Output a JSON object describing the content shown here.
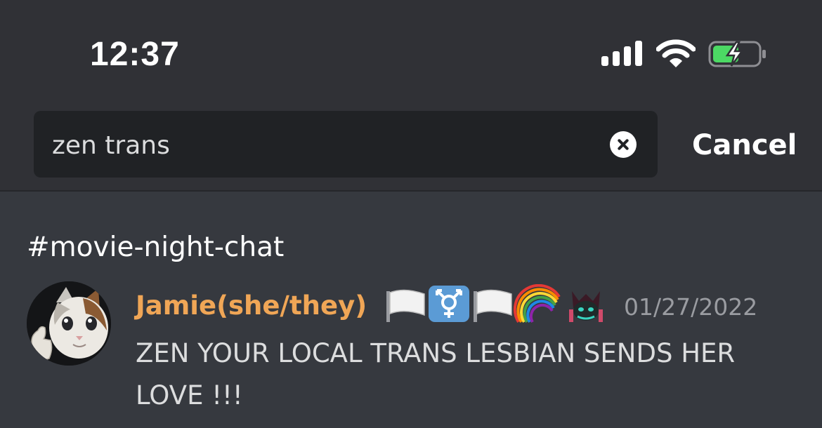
{
  "status_bar": {
    "time": "12:37",
    "signal_bars": 4,
    "battery_charging": true,
    "battery_level": 0.55,
    "battery_color": "#4cd964"
  },
  "search": {
    "query": "zen trans",
    "cancel_label": "Cancel"
  },
  "results": {
    "channel": "#movie-night-chat",
    "message": {
      "author": "Jamie(she/they)",
      "author_color": "#f0a656",
      "badges": [
        "white-flag",
        "transgender-symbol",
        "white-flag",
        "rainbow",
        "custom-emoji"
      ],
      "timestamp": "01/27/2022",
      "content": "ZEN YOUR LOCAL TRANS LESBIAN SENDS HER LOVE !!!"
    }
  }
}
